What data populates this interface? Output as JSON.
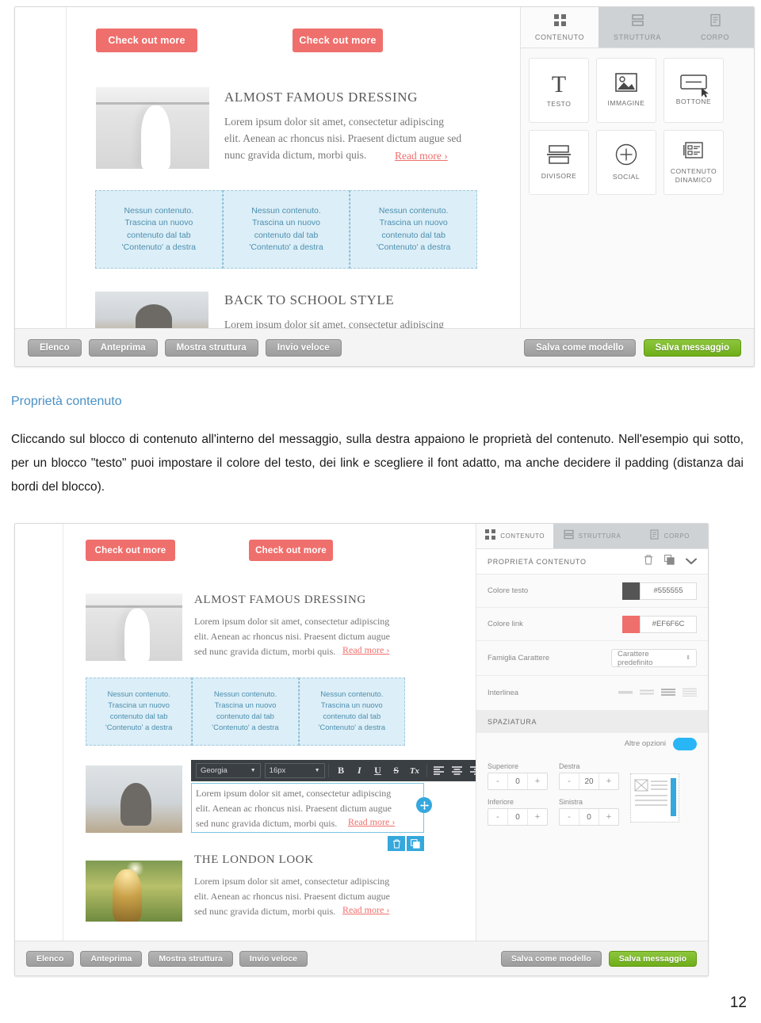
{
  "page": {
    "number": "12"
  },
  "prose": {
    "heading": "Proprietà contenuto",
    "paragraph": "Cliccando sul blocco di contenuto all'interno del messaggio, sulla destra appaiono le proprietà del contenuto. Nell'esempio qui sotto, per un blocco \"testo\" puoi impostare il colore del testo, dei link e scegliere il font adatto, ma anche decidere il padding (distanza dai bordi del blocco)."
  },
  "colors": {
    "accent_red": "#EF6F6C",
    "heading_blue": "#4A90C4",
    "save_green": "#6FAE19",
    "dropzone_bg": "#DCEEF7",
    "dropzone_text": "#4C8FAF",
    "selection_blue": "#35A8DD",
    "text_color_value": "#555555"
  },
  "screenshot_top": {
    "email": {
      "cta_buttons": [
        {
          "label": "Check out more"
        },
        {
          "label": "Check out more"
        }
      ],
      "articles": [
        {
          "title": "ALMOST FAMOUS DRESSING",
          "body": "Lorem ipsum dolor sit amet, consectetur adipiscing elit. Aenean ac rhoncus nisi. Praesent dictum augue sed nunc gravida dictum, morbi quis.",
          "link": "Read more ›",
          "image_alt": "woman-subway-photo"
        },
        {
          "title": "BACK TO SCHOOL STYLE",
          "body": "Lorem ipsum dolor sit amet, consectetur adipiscing",
          "link": "",
          "image_alt": "person-beanie-photo"
        }
      ],
      "dropzones": [
        {
          "text": "Nessun contenuto.\nTrascina un nuovo\ncontenuto dal tab\n'Contenuto' a destra"
        },
        {
          "text": "Nessun contenuto.\nTrascina un nuovo\ncontenuto dal tab\n'Contenuto' a destra"
        },
        {
          "text": "Nessun contenuto.\nTrascina un nuovo\ncontenuto dal tab\n'Contenuto' a destra"
        }
      ]
    },
    "sidebar": {
      "tabs": [
        {
          "label": "CONTENUTO",
          "icon": "grid-icon",
          "active": true
        },
        {
          "label": "STRUTTURA",
          "icon": "rows-icon",
          "active": false
        },
        {
          "label": "CORPO",
          "icon": "document-icon",
          "active": false
        }
      ],
      "blocks": [
        {
          "label": "TESTO",
          "icon": "text-t-icon"
        },
        {
          "label": "IMMAGINE",
          "icon": "image-icon"
        },
        {
          "label": "BOTTONE",
          "icon": "button-icon"
        },
        {
          "label": "DIVISORE",
          "icon": "divider-icon"
        },
        {
          "label": "SOCIAL",
          "icon": "plus-circle-icon"
        },
        {
          "label": "CONTENUTO DINAMICO",
          "icon": "dynamic-content-icon"
        }
      ]
    },
    "footer": {
      "left_buttons": [
        {
          "label": "Elenco"
        },
        {
          "label": "Anteprima"
        },
        {
          "label": "Mostra struttura"
        },
        {
          "label": "Invio veloce"
        }
      ],
      "right_buttons": [
        {
          "label": "Salva come modello",
          "style": "gray"
        },
        {
          "label": "Salva messaggio",
          "style": "green"
        }
      ]
    }
  },
  "screenshot_bottom": {
    "email": {
      "cta_buttons": [
        {
          "label": "Check out more"
        },
        {
          "label": "Check out more"
        }
      ],
      "articles": [
        {
          "title": "ALMOST FAMOUS DRESSING",
          "body": "Lorem ipsum dolor sit amet, consectetur adipiscing elit. Aenean ac rhoncus nisi. Praesent dictum augue sed nunc gravida dictum, morbi quis.",
          "link": "Read more ›"
        },
        {
          "title": "THE LONDON LOOK",
          "body": "Lorem ipsum dolor sit amet, consectetur adipiscing elit. Aenean ac rhoncus nisi. Praesent dictum augue sed nunc gravida dictum, morbi quis.",
          "link": "Read more ›"
        }
      ],
      "dropzones": [
        {
          "text": "Nessun contenuto.\nTrascina un nuovo\ncontenuto dal tab\n'Contenuto' a destra"
        },
        {
          "text": "Nessun contenuto.\nTrascina un nuovo\ncontenuto dal tab\n'Contenuto' a destra"
        },
        {
          "text": "Nessun contenuto.\nTrascina un nuovo\ncontenuto dal tab\n'Contenuto' a destra"
        }
      ],
      "selected_block": {
        "body": "Lorem ipsum dolor sit amet, consectetur adipiscing elit. Aenean ac rhoncus nisi. Praesent dictum augue sed nunc gravida dictum, morbi quis.",
        "link": "Read more ›"
      }
    },
    "editor_toolbar": {
      "font_family": "Georgia",
      "font_size": "16px",
      "buttons": [
        {
          "label": "B",
          "name": "bold-icon"
        },
        {
          "label": "I",
          "name": "italic-icon"
        },
        {
          "label": "U",
          "name": "underline-icon"
        },
        {
          "label": "S",
          "name": "strikethrough-icon"
        },
        {
          "label": "Tx",
          "name": "clear-format-icon"
        },
        {
          "label": "",
          "name": "align-left-icon"
        },
        {
          "label": "",
          "name": "align-center-icon"
        },
        {
          "label": "",
          "name": "align-right-icon"
        },
        {
          "label": "",
          "name": "align-justify-icon"
        },
        {
          "label": "",
          "name": "link-icon"
        },
        {
          "label": "",
          "name": "unlink-icon"
        },
        {
          "label": "",
          "name": "undo-icon"
        },
        {
          "label": "",
          "name": "redo-icon"
        },
        {
          "label": "",
          "name": "collapse-chevron-icon"
        }
      ]
    },
    "sidebar": {
      "tabs": [
        {
          "label": "CONTENUTO",
          "icon": "grid-icon",
          "active": true
        },
        {
          "label": "STRUTTURA",
          "icon": "rows-icon",
          "active": false
        },
        {
          "label": "CORPO",
          "icon": "document-icon",
          "active": false
        }
      ],
      "properties_header": {
        "title": "PROPRIETÀ CONTENUTO",
        "actions": [
          {
            "name": "delete-icon"
          },
          {
            "name": "duplicate-icon"
          },
          {
            "name": "chevron-down-icon"
          }
        ]
      },
      "properties": [
        {
          "label": "Colore testo",
          "value": "#555555",
          "swatch": "#555555",
          "type": "color"
        },
        {
          "label": "Colore link",
          "value": "#EF6F6C",
          "swatch": "#EF6F6C",
          "type": "color"
        },
        {
          "label": "Famiglia Carattere",
          "value": "Carattere predefinito",
          "type": "select"
        },
        {
          "label": "Interlinea",
          "value": "",
          "type": "lineheight"
        }
      ],
      "spacing": {
        "section_title": "SPAZIATURA",
        "more_options_label": "Altre opzioni",
        "more_options_on": true,
        "fields": [
          {
            "label": "Superiore",
            "value": "0"
          },
          {
            "label": "Destra",
            "value": "20"
          },
          {
            "label": "Inferiore",
            "value": "0"
          },
          {
            "label": "Sinistra",
            "value": "0"
          }
        ],
        "minus": "-",
        "plus": "+"
      }
    },
    "footer": {
      "left_buttons": [
        {
          "label": "Elenco"
        },
        {
          "label": "Anteprima"
        },
        {
          "label": "Mostra struttura"
        },
        {
          "label": "Invio veloce"
        }
      ],
      "right_buttons": [
        {
          "label": "Salva come modello",
          "style": "gray"
        },
        {
          "label": "Salva messaggio",
          "style": "green"
        }
      ]
    }
  }
}
